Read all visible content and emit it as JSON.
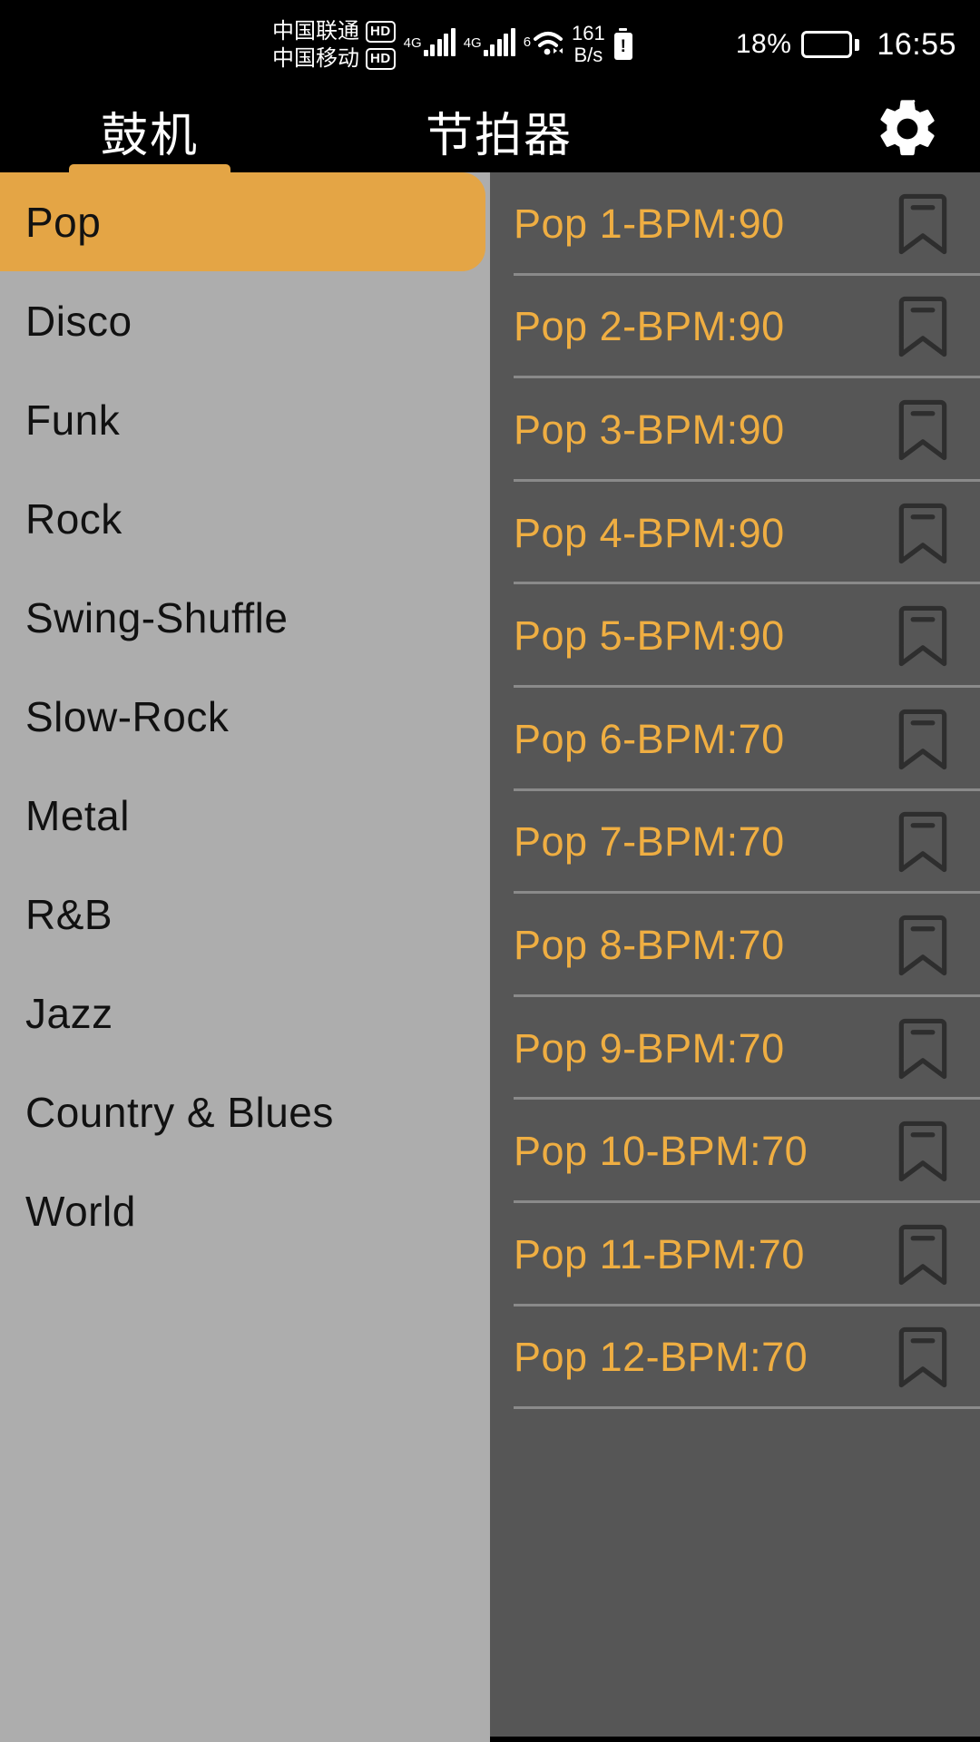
{
  "statusbar": {
    "carriers": [
      {
        "name": "中国联通",
        "badge": "HD"
      },
      {
        "name": "中国移动",
        "badge": "HD"
      }
    ],
    "signals": [
      {
        "generation": "4G"
      },
      {
        "generation": "4G"
      }
    ],
    "wifi": {
      "generation": "6"
    },
    "network_speed": {
      "value": "161",
      "unit": "B/s"
    },
    "battery": {
      "percent": "18%",
      "level": 18
    },
    "time": "16:55",
    "icons": {
      "warning_battery": "battery-warning-icon",
      "wifi": "wifi-icon",
      "signal": "signal-bars-icon",
      "battery": "battery-icon"
    }
  },
  "tabs": {
    "items": [
      {
        "label": "鼓机",
        "active": true
      },
      {
        "label": "节拍器",
        "active": false
      }
    ],
    "settings_icon": "gear-icon"
  },
  "sidebar": {
    "items": [
      {
        "label": "Pop",
        "selected": true
      },
      {
        "label": "Disco",
        "selected": false
      },
      {
        "label": "Funk",
        "selected": false
      },
      {
        "label": "Rock",
        "selected": false
      },
      {
        "label": "Swing-Shuffle",
        "selected": false
      },
      {
        "label": "Slow-Rock",
        "selected": false
      },
      {
        "label": "Metal",
        "selected": false
      },
      {
        "label": "R&B",
        "selected": false
      },
      {
        "label": "Jazz",
        "selected": false
      },
      {
        "label": "Country & Blues",
        "selected": false
      },
      {
        "label": "World",
        "selected": false
      }
    ]
  },
  "patterns": {
    "bookmark_icon": "bookmark-icon",
    "items": [
      {
        "label": "Pop 1-BPM:90",
        "name": "Pop 1",
        "bpm": 90
      },
      {
        "label": "Pop 2-BPM:90",
        "name": "Pop 2",
        "bpm": 90
      },
      {
        "label": "Pop 3-BPM:90",
        "name": "Pop 3",
        "bpm": 90
      },
      {
        "label": "Pop 4-BPM:90",
        "name": "Pop 4",
        "bpm": 90
      },
      {
        "label": "Pop 5-BPM:90",
        "name": "Pop 5",
        "bpm": 90
      },
      {
        "label": "Pop 6-BPM:70",
        "name": "Pop 6",
        "bpm": 70
      },
      {
        "label": "Pop 7-BPM:70",
        "name": "Pop 7",
        "bpm": 70
      },
      {
        "label": "Pop 8-BPM:70",
        "name": "Pop 8",
        "bpm": 70
      },
      {
        "label": "Pop 9-BPM:70",
        "name": "Pop 9",
        "bpm": 70
      },
      {
        "label": "Pop 10-BPM:70",
        "name": "Pop 10",
        "bpm": 70
      },
      {
        "label": "Pop 11-BPM:70",
        "name": "Pop 11",
        "bpm": 70
      },
      {
        "label": "Pop 12-BPM:70",
        "name": "Pop 12",
        "bpm": 70
      }
    ]
  },
  "colors": {
    "accent_orange": "#E4A545",
    "list_text_orange": "#EFAE42",
    "sidebar_bg": "#ADADAD",
    "panel_bg": "#565656",
    "bar_bg": "#000000",
    "divider": "#8A8A8A",
    "battery_fill": "#F09A28"
  }
}
